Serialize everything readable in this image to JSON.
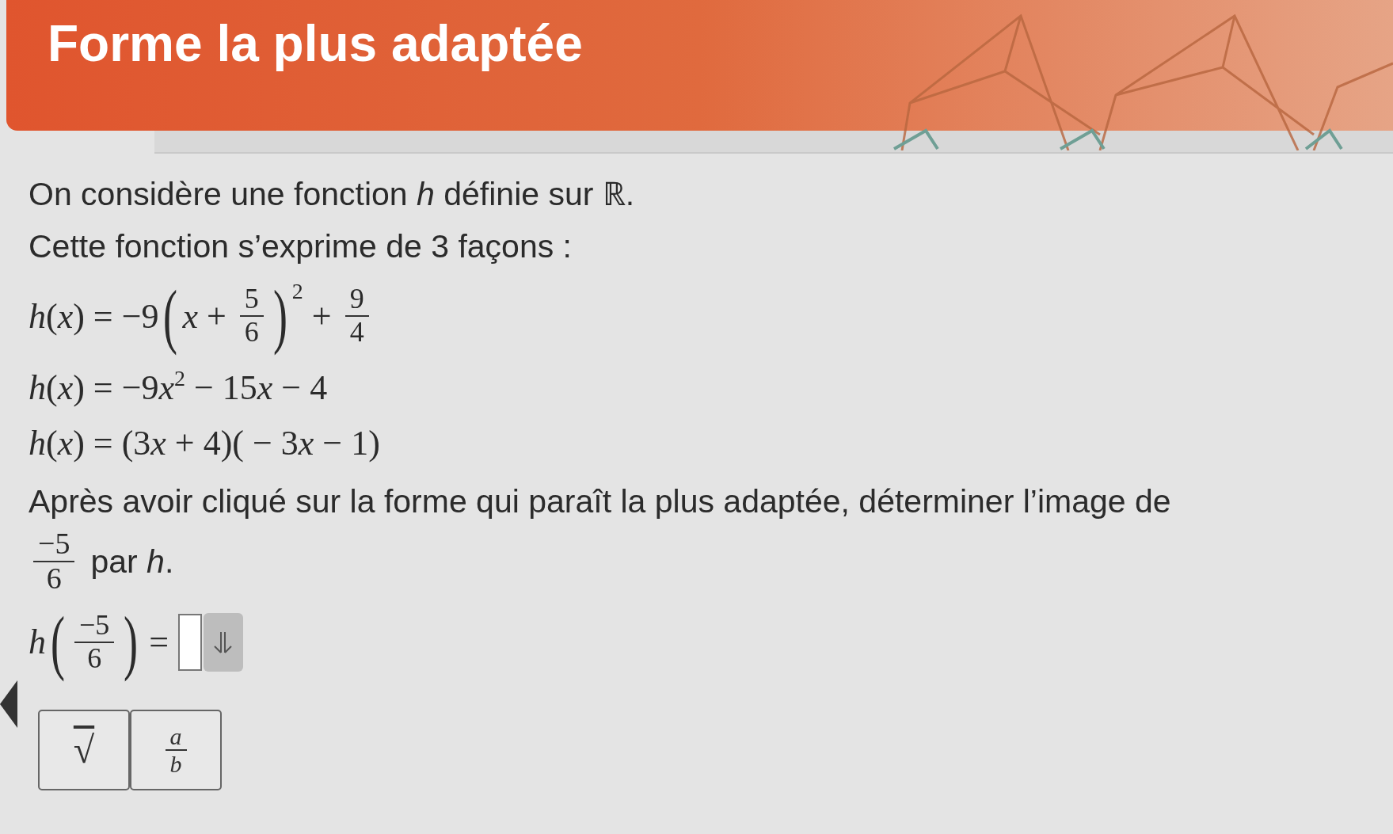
{
  "header": {
    "title": "Forme la plus adaptée"
  },
  "intro": [
    "On considère une fonction *h* définie sur ℝ.",
    "Cette fonction s’exprime de 3 façons :"
  ],
  "formulas": [
    [
      {
        "kind": "text",
        "t": "*h*(*x*) = −9"
      },
      {
        "kind": "lparen",
        "t": "("
      },
      {
        "kind": "text",
        "t": "*x* + "
      },
      {
        "kind": "frac",
        "num": "5",
        "den": "6"
      },
      {
        "kind": "rparen",
        "t": ")"
      },
      {
        "kind": "sup",
        "t": "2"
      },
      {
        "kind": "text",
        "t": " + "
      },
      {
        "kind": "frac",
        "num": "9",
        "den": "4"
      }
    ],
    [
      {
        "kind": "text",
        "t": "*h*(*x*) = −9"
      },
      {
        "kind": "var",
        "t": "x"
      },
      {
        "kind": "sup",
        "t": "2"
      },
      {
        "kind": "text",
        "t": " − 15"
      },
      {
        "kind": "var",
        "t": "x"
      },
      {
        "kind": "text",
        "t": " − 4"
      }
    ],
    [
      {
        "kind": "text",
        "t": "*h*(*x*) = (3"
      },
      {
        "kind": "var",
        "t": "x"
      },
      {
        "kind": "text",
        "t": " + 4)( − 3"
      },
      {
        "kind": "var",
        "t": "x"
      },
      {
        "kind": "text",
        "t": " − 1)"
      }
    ]
  ],
  "question": {
    "sentence": "Après avoir cliqué sur la forme qui paraît la plus adaptée, déterminer l’image de",
    "frac": {
      "num": "−5",
      "den": "6"
    },
    "tail": "par *h*."
  },
  "answer": {
    "prefix": "*h*",
    "lparen": "(",
    "frac": {
      "num": "−5",
      "den": "6"
    },
    "rparen": ")",
    "equals": "="
  },
  "keypad": [
    {
      "kind": "sqrt",
      "t": "√"
    },
    {
      "kind": "frac",
      "num": "a",
      "den": "b"
    }
  ]
}
